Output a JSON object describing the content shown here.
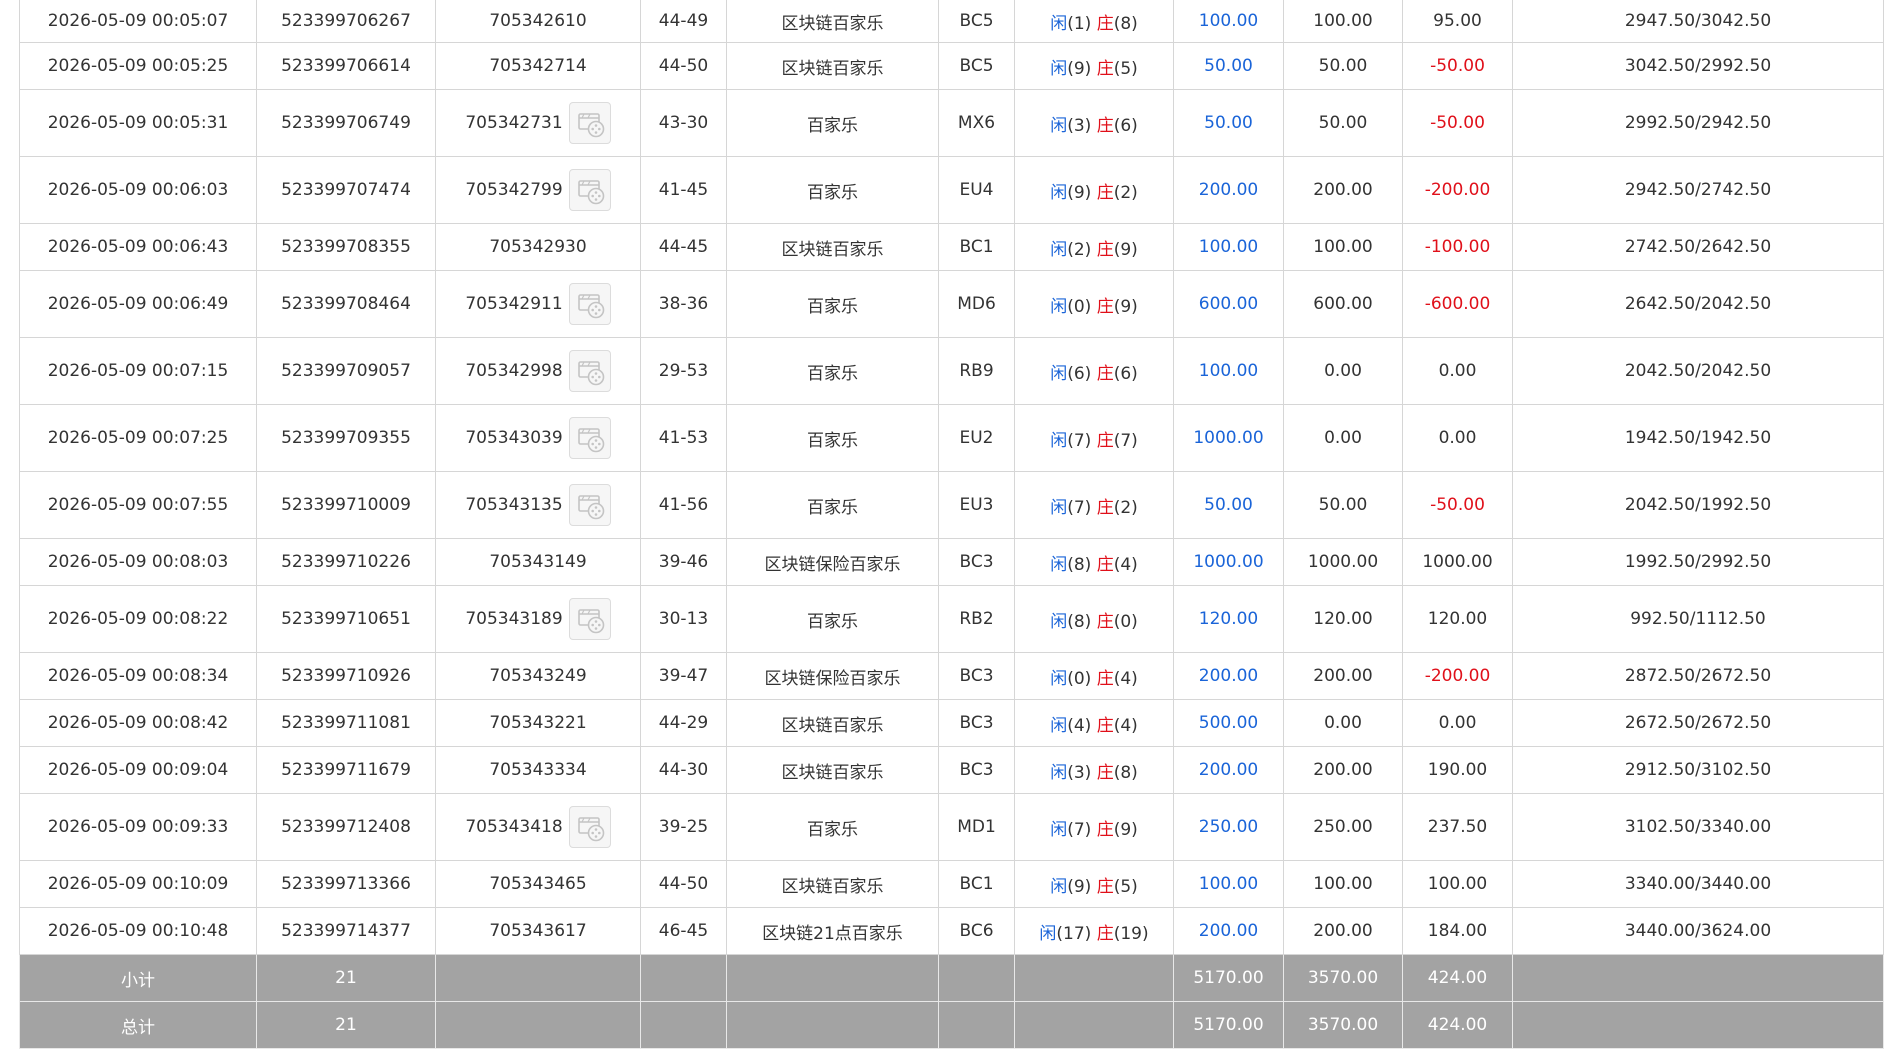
{
  "rows": [
    {
      "time": "2026-05-09 00:05:07",
      "order": "523399706267",
      "round": "705342610",
      "video": false,
      "table": "44-49",
      "game": "区块链百家乐",
      "code": "BC5",
      "p": "(1)",
      "b": "(8)",
      "bet": "100.00",
      "valid": "100.00",
      "win": "95.00",
      "win_neg": false,
      "balance": "2947.50/3042.50"
    },
    {
      "time": "2026-05-09 00:05:25",
      "order": "523399706614",
      "round": "705342714",
      "video": false,
      "table": "44-50",
      "game": "区块链百家乐",
      "code": "BC5",
      "p": "(9)",
      "b": "(5)",
      "bet": "50.00",
      "valid": "50.00",
      "win": "-50.00",
      "win_neg": true,
      "balance": "3042.50/2992.50"
    },
    {
      "time": "2026-05-09 00:05:31",
      "order": "523399706749",
      "round": "705342731",
      "video": true,
      "table": "43-30",
      "game": "百家乐",
      "code": "MX6",
      "p": "(3)",
      "b": "(6)",
      "bet": "50.00",
      "valid": "50.00",
      "win": "-50.00",
      "win_neg": true,
      "balance": "2992.50/2942.50"
    },
    {
      "time": "2026-05-09 00:06:03",
      "order": "523399707474",
      "round": "705342799",
      "video": true,
      "table": "41-45",
      "game": "百家乐",
      "code": "EU4",
      "p": "(9)",
      "b": "(2)",
      "bet": "200.00",
      "valid": "200.00",
      "win": "-200.00",
      "win_neg": true,
      "balance": "2942.50/2742.50"
    },
    {
      "time": "2026-05-09 00:06:43",
      "order": "523399708355",
      "round": "705342930",
      "video": false,
      "table": "44-45",
      "game": "区块链百家乐",
      "code": "BC1",
      "p": "(2)",
      "b": "(9)",
      "bet": "100.00",
      "valid": "100.00",
      "win": "-100.00",
      "win_neg": true,
      "balance": "2742.50/2642.50"
    },
    {
      "time": "2026-05-09 00:06:49",
      "order": "523399708464",
      "round": "705342911",
      "video": true,
      "table": "38-36",
      "game": "百家乐",
      "code": "MD6",
      "p": "(0)",
      "b": "(9)",
      "bet": "600.00",
      "valid": "600.00",
      "win": "-600.00",
      "win_neg": true,
      "balance": "2642.50/2042.50"
    },
    {
      "time": "2026-05-09 00:07:15",
      "order": "523399709057",
      "round": "705342998",
      "video": true,
      "table": "29-53",
      "game": "百家乐",
      "code": "RB9",
      "p": "(6)",
      "b": "(6)",
      "bet": "100.00",
      "valid": "0.00",
      "win": "0.00",
      "win_neg": false,
      "balance": "2042.50/2042.50"
    },
    {
      "time": "2026-05-09 00:07:25",
      "order": "523399709355",
      "round": "705343039",
      "video": true,
      "table": "41-53",
      "game": "百家乐",
      "code": "EU2",
      "p": "(7)",
      "b": "(7)",
      "bet": "1000.00",
      "valid": "0.00",
      "win": "0.00",
      "win_neg": false,
      "balance": "1942.50/1942.50"
    },
    {
      "time": "2026-05-09 00:07:55",
      "order": "523399710009",
      "round": "705343135",
      "video": true,
      "table": "41-56",
      "game": "百家乐",
      "code": "EU3",
      "p": "(7)",
      "b": "(2)",
      "bet": "50.00",
      "valid": "50.00",
      "win": "-50.00",
      "win_neg": true,
      "balance": "2042.50/1992.50"
    },
    {
      "time": "2026-05-09 00:08:03",
      "order": "523399710226",
      "round": "705343149",
      "video": false,
      "table": "39-46",
      "game": "区块链保险百家乐",
      "code": "BC3",
      "p": "(8)",
      "b": "(4)",
      "bet": "1000.00",
      "valid": "1000.00",
      "win": "1000.00",
      "win_neg": false,
      "balance": "1992.50/2992.50"
    },
    {
      "time": "2026-05-09 00:08:22",
      "order": "523399710651",
      "round": "705343189",
      "video": true,
      "table": "30-13",
      "game": "百家乐",
      "code": "RB2",
      "p": "(8)",
      "b": "(0)",
      "bet": "120.00",
      "valid": "120.00",
      "win": "120.00",
      "win_neg": false,
      "balance": "992.50/1112.50"
    },
    {
      "time": "2026-05-09 00:08:34",
      "order": "523399710926",
      "round": "705343249",
      "video": false,
      "table": "39-47",
      "game": "区块链保险百家乐",
      "code": "BC3",
      "p": "(0)",
      "b": "(4)",
      "bet": "200.00",
      "valid": "200.00",
      "win": "-200.00",
      "win_neg": true,
      "balance": "2872.50/2672.50"
    },
    {
      "time": "2026-05-09 00:08:42",
      "order": "523399711081",
      "round": "705343221",
      "video": false,
      "table": "44-29",
      "game": "区块链百家乐",
      "code": "BC3",
      "p": "(4)",
      "b": "(4)",
      "bet": "500.00",
      "valid": "0.00",
      "win": "0.00",
      "win_neg": false,
      "balance": "2672.50/2672.50"
    },
    {
      "time": "2026-05-09 00:09:04",
      "order": "523399711679",
      "round": "705343334",
      "video": false,
      "table": "44-30",
      "game": "区块链百家乐",
      "code": "BC3",
      "p": "(3)",
      "b": "(8)",
      "bet": "200.00",
      "valid": "200.00",
      "win": "190.00",
      "win_neg": false,
      "balance": "2912.50/3102.50"
    },
    {
      "time": "2026-05-09 00:09:33",
      "order": "523399712408",
      "round": "705343418",
      "video": true,
      "table": "39-25",
      "game": "百家乐",
      "code": "MD1",
      "p": "(7)",
      "b": "(9)",
      "bet": "250.00",
      "valid": "250.00",
      "win": "237.50",
      "win_neg": false,
      "balance": "3102.50/3340.00"
    },
    {
      "time": "2026-05-09 00:10:09",
      "order": "523399713366",
      "round": "705343465",
      "video": false,
      "table": "44-50",
      "game": "区块链百家乐",
      "code": "BC1",
      "p": "(9)",
      "b": "(5)",
      "bet": "100.00",
      "valid": "100.00",
      "win": "100.00",
      "win_neg": false,
      "balance": "3340.00/3440.00"
    },
    {
      "time": "2026-05-09 00:10:48",
      "order": "523399714377",
      "round": "705343617",
      "video": false,
      "table": "46-45",
      "game": "区块链21点百家乐",
      "code": "BC6",
      "p": "(17)",
      "b": "(19)",
      "bet": "200.00",
      "valid": "200.00",
      "win": "184.00",
      "win_neg": false,
      "balance": "3440.00/3624.00"
    }
  ],
  "labels": {
    "player": "闲",
    "banker": "庄",
    "video_icon": "video-replay-icon"
  },
  "subtotal": {
    "label": "小计",
    "count": "21",
    "bet": "5170.00",
    "valid": "3570.00",
    "win": "424.00"
  },
  "total": {
    "label": "总计",
    "count": "21",
    "bet": "5170.00",
    "valid": "3570.00",
    "win": "424.00"
  },
  "colors": {
    "bet_blue": "#1a64d8",
    "loss_red": "#e0101a",
    "summary_bg": "#a3a3a3"
  }
}
